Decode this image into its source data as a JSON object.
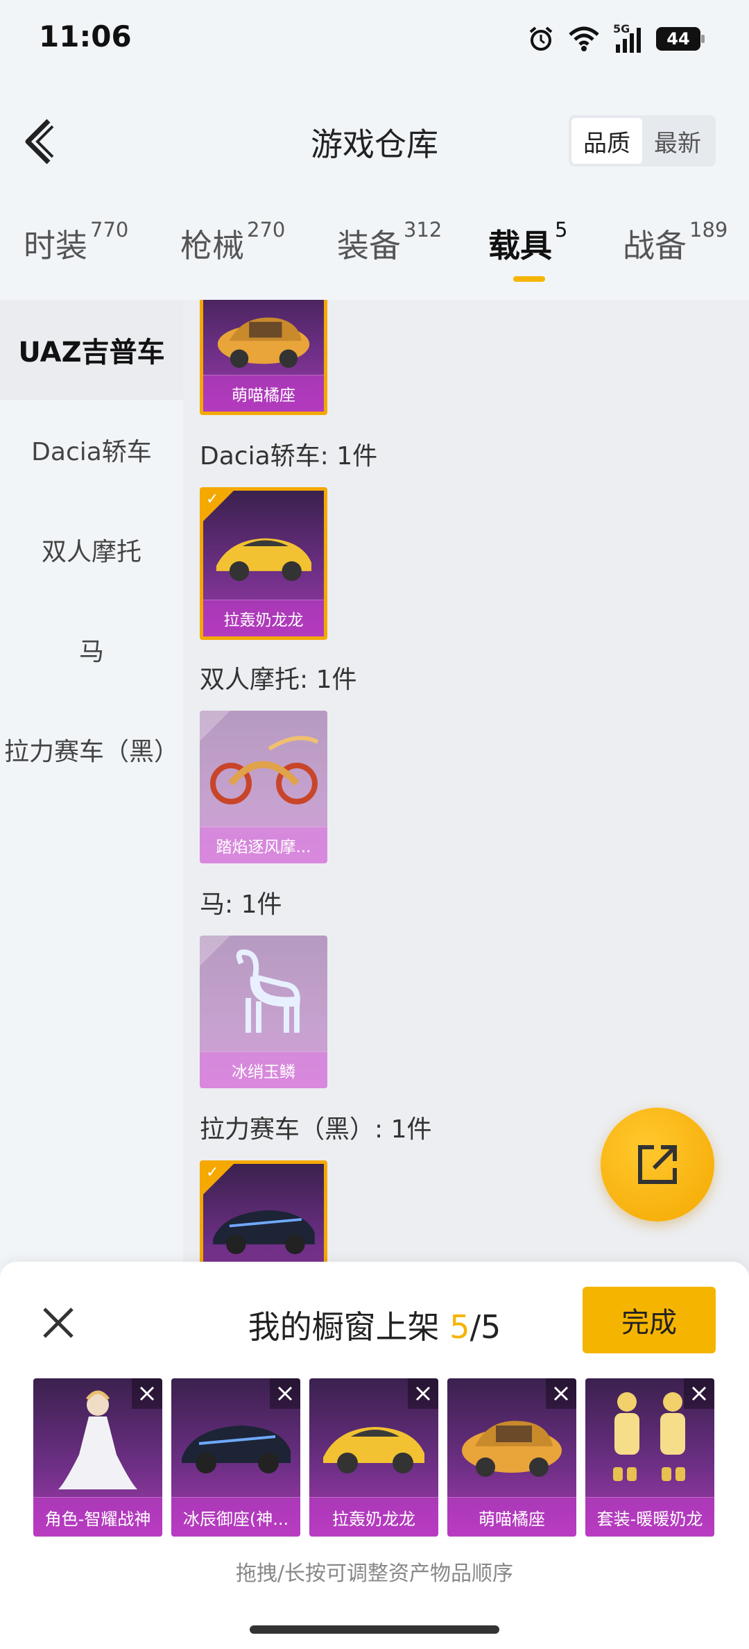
{
  "status_bar": {
    "time": "11:06",
    "battery": "44",
    "network": "5G"
  },
  "header": {
    "title": "游戏仓库",
    "sort_options": [
      "品质",
      "最新"
    ],
    "sort_active": 0
  },
  "tabs": [
    {
      "label": "时装",
      "count": "770"
    },
    {
      "label": "枪械",
      "count": "270"
    },
    {
      "label": "装备",
      "count": "312"
    },
    {
      "label": "载具",
      "count": "5"
    },
    {
      "label": "战备",
      "count": "189"
    }
  ],
  "active_tab": 3,
  "sidebar": {
    "items": [
      "UAZ吉普车",
      "Dacia轿车",
      "双人摩托",
      "马",
      "拉力赛车（黑）"
    ],
    "active": 0
  },
  "content": {
    "first_item": {
      "name": "萌喵橘座",
      "selected": true
    },
    "groups": [
      {
        "label": "Dacia轿车: 1件",
        "item": {
          "name": "拉轰奶龙龙",
          "selected": true
        }
      },
      {
        "label": "双人摩托: 1件",
        "item": {
          "name": "踏焰逐风摩...",
          "selected": false
        }
      },
      {
        "label": "马: 1件",
        "item": {
          "name": "冰绡玉鳞",
          "selected": false
        }
      },
      {
        "label": "拉力赛车（黑）: 1件",
        "item": {
          "name": "",
          "selected": true
        }
      }
    ]
  },
  "fab": {
    "icon": "share-icon"
  },
  "shelf": {
    "title": "我的橱窗上架",
    "count": "5",
    "total": "/5",
    "done_label": "完成",
    "items": [
      "角色-智耀战神",
      "冰辰御座(神...",
      "拉轰奶龙龙",
      "萌喵橘座",
      "套装-暖暖奶龙"
    ],
    "hint": "拖拽/长按可调整资产物品顺序"
  },
  "colors": {
    "accent": "#f5b400",
    "rarity_purple": "#6d2f85"
  }
}
